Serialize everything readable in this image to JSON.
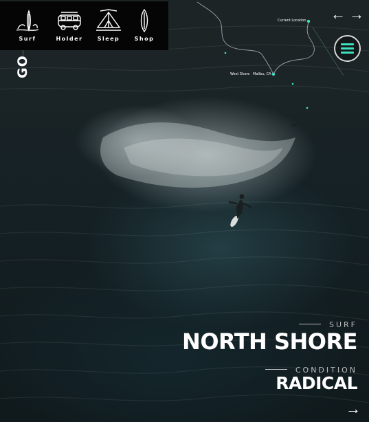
{
  "nav": {
    "items": [
      {
        "label": "Surf",
        "icon": "surf-icon"
      },
      {
        "label": "Holder",
        "icon": "van-icon"
      },
      {
        "label": "Sleep",
        "icon": "tent-icon"
      },
      {
        "label": "Shop",
        "icon": "surfboard-icon"
      }
    ]
  },
  "side": {
    "go_label": "GO"
  },
  "controls": {
    "prev_arrow": "←",
    "next_arrow": "→",
    "bottom_arrow": "→",
    "menu_icon": "hamburger-icon",
    "accent": "#3fe0c0"
  },
  "map": {
    "current_location": "Current Location",
    "west_shore": "West Shore",
    "malibu": "Malibu, CA"
  },
  "spot": {
    "category": "SURF",
    "name": "NORTH SHORE",
    "condition_label": "CONDITION",
    "condition_value": "RADICAL"
  }
}
